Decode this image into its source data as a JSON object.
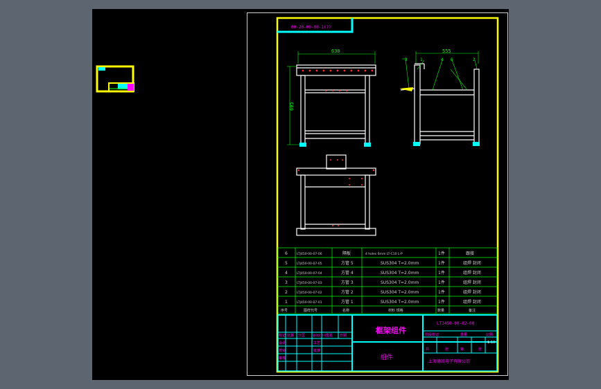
{
  "drawing": {
    "top_code": "00-20-00-00-1(?)",
    "dimensions": {
      "width_front": "630",
      "width_side": "555",
      "height": "695"
    },
    "side_callouts": [
      "3",
      "1",
      "4",
      "6",
      "2"
    ],
    "bom_rows": [
      {
        "no": "6",
        "code": "LTJ450-00-07-06",
        "name": "隔板",
        "material": "4 holes 6mm LT-C10 L-P",
        "qty": "1件",
        "note": "跟接"
      },
      {
        "no": "5",
        "code": "LTJ450-00-07-05",
        "name": "方管 5",
        "material": "SUS304 T=2.0mm",
        "qty": "1件",
        "note": "组焊 封闭"
      },
      {
        "no": "4",
        "code": "LTJ450-00-07-04",
        "name": "方管 4",
        "material": "SUS304 T=2.0mm",
        "qty": "1件",
        "note": "组焊 封闭"
      },
      {
        "no": "3",
        "code": "LTJ450-00-07-03",
        "name": "方管 3",
        "material": "SUS304 T=2.0mm",
        "qty": "1件",
        "note": "组焊 封闭"
      },
      {
        "no": "2",
        "code": "LTJ450-00-07-02",
        "name": "方管 2",
        "material": "SUS304 T=2.0mm",
        "qty": "1件",
        "note": "组焊 封闭"
      },
      {
        "no": "1",
        "code": "LTJ450-00-07-01",
        "name": "方管 1",
        "material": "SUS304 T=2.0mm",
        "qty": "1件",
        "note": "组焊 封闭"
      }
    ],
    "bom_header": {
      "no": "序号",
      "code": "图样代号",
      "name": "名称",
      "material": "材料 规格",
      "qty": "数量",
      "note": "备注"
    },
    "title_block": {
      "title": "框架组件",
      "subtitle": "组件",
      "drawing_no": "LTJ450-00-02-00",
      "scale": "1:10",
      "company": "上海德凯电子有限公司",
      "row_labels": [
        "设计",
        "校对",
        "审核",
        "工艺",
        "批准"
      ],
      "stage_labels": [
        "阶段标记",
        "重量",
        "比例"
      ],
      "sheet_labels": [
        "共",
        "张",
        "第",
        "张"
      ],
      "rev_labels": [
        "标记",
        "处数",
        "分区",
        "更改文件号",
        "签名",
        "日期"
      ]
    },
    "colors": {
      "frame": "#ffff00",
      "lines": "#ffffff",
      "dims": "#00ff00",
      "markers": "#00ffff",
      "holes": "#ff3030",
      "text": "#ff00ff"
    }
  }
}
